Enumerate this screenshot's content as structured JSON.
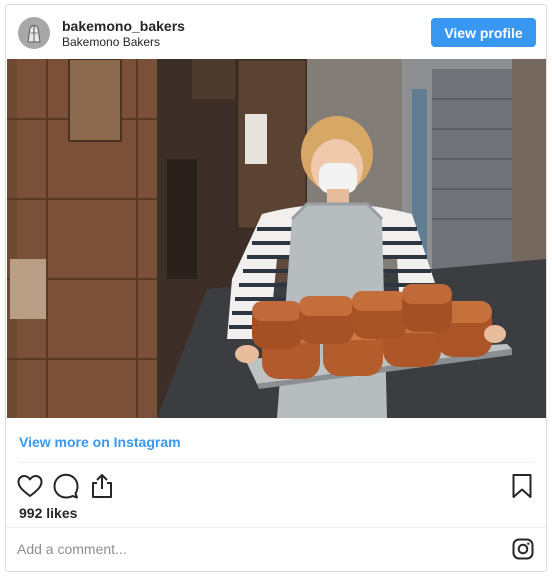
{
  "header": {
    "username": "bakemono_bakers",
    "full_name": "Bakemono Bakers",
    "view_profile_label": "View profile"
  },
  "footer": {
    "view_more_label": "View more on Instagram",
    "likes_text": "992 likes",
    "comment_placeholder": "Add a comment..."
  },
  "icons": {
    "avatar": "bakemono-logo-icon",
    "like": "heart-icon",
    "comment": "speech-bubble-icon",
    "share": "share-icon",
    "save": "bookmark-icon",
    "brand": "instagram-logo-icon"
  },
  "colors": {
    "accent_blue": "#3897f0",
    "border": "#dbdbdb",
    "text": "#262626",
    "muted": "#8e8e8e"
  }
}
